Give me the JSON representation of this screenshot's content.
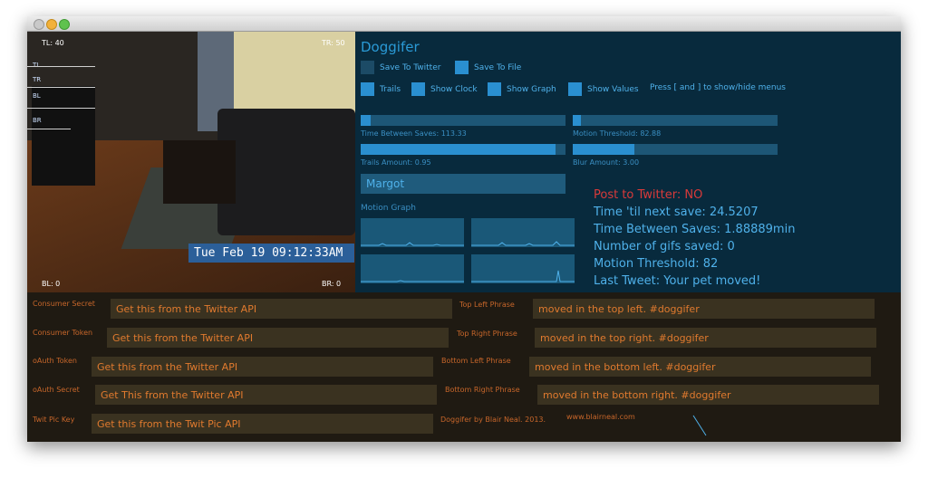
{
  "camera": {
    "label_tl": "TL: 40",
    "label_tr": "TR: 50",
    "label_bl": "BL: 0",
    "label_br": "BR: 0",
    "ticks": [
      "TL",
      "TR",
      "BL",
      "BR"
    ],
    "timestamp": "Tue Feb 19 09:12:33AM"
  },
  "panel": {
    "title": "Doggifer",
    "save_to_twitter": "Save To Twitter",
    "save_to_file": "Save To File",
    "trails": "Trails",
    "show_clock": "Show Clock",
    "show_graph": "Show Graph",
    "show_values": "Show Values",
    "hint": "Press [ and ] to show/hide menus",
    "sliders": {
      "time_between_saves": {
        "label": "Time Between Saves: 113.33",
        "fraction": 0.05
      },
      "motion_threshold": {
        "label": "Motion Threshold: 82.88",
        "fraction": 0.04
      },
      "trails_amount": {
        "label": "Trails Amount: 0.95",
        "fraction": 0.95
      },
      "blur_amount": {
        "label": "Blur Amount: 3.00",
        "fraction": 0.3
      }
    },
    "name_value": "Margot",
    "motion_graph_label": "Motion Graph",
    "stats": {
      "post_to_twitter": "Post to Twitter: NO",
      "time_til_next": "Time 'til next save: 24.5207",
      "time_between": "Time Between Saves: 1.88889min",
      "gifs_saved": "Number of gifs saved: 0",
      "motion_threshold": "Motion Threshold: 82",
      "last_tweet": "Last Tweet: Your pet moved!"
    }
  },
  "config": {
    "consumer_secret_label": "Consumer Secret",
    "consumer_secret_value": "Get this from the Twitter API",
    "consumer_token_label": "Consumer Token",
    "consumer_token_value": "Get this from the Twitter API",
    "oauth_token_label": "oAuth Token",
    "oauth_token_value": "Get this from the Twitter API",
    "oauth_secret_label": "oAuth Secret",
    "oauth_secret_value": "Get This from the Twitter API",
    "twitpic_label": "Twit Pic Key",
    "twitpic_value": "Get this from the Twit Pic API",
    "top_left_label": "Top Left Phrase",
    "top_left_value": "moved in the top left. #doggifer",
    "top_right_label": "Top Right Phrase",
    "top_right_value": "moved in the top right. #doggifer",
    "bottom_left_label": "Bottom Left Phrase",
    "bottom_left_value": "moved in the bottom left. #doggifer",
    "bottom_right_label": "Bottom Right Phrase",
    "bottom_right_value": "moved in the bottom right. #doggifer",
    "credit": "Doggifer by Blair Neal. 2013.",
    "url": "www.blairneal.com"
  },
  "colors": {
    "panel_bg": "#082a3d",
    "accent": "#2a8fd0",
    "config_text": "#e07a2e",
    "alert": "#d93a3a"
  }
}
